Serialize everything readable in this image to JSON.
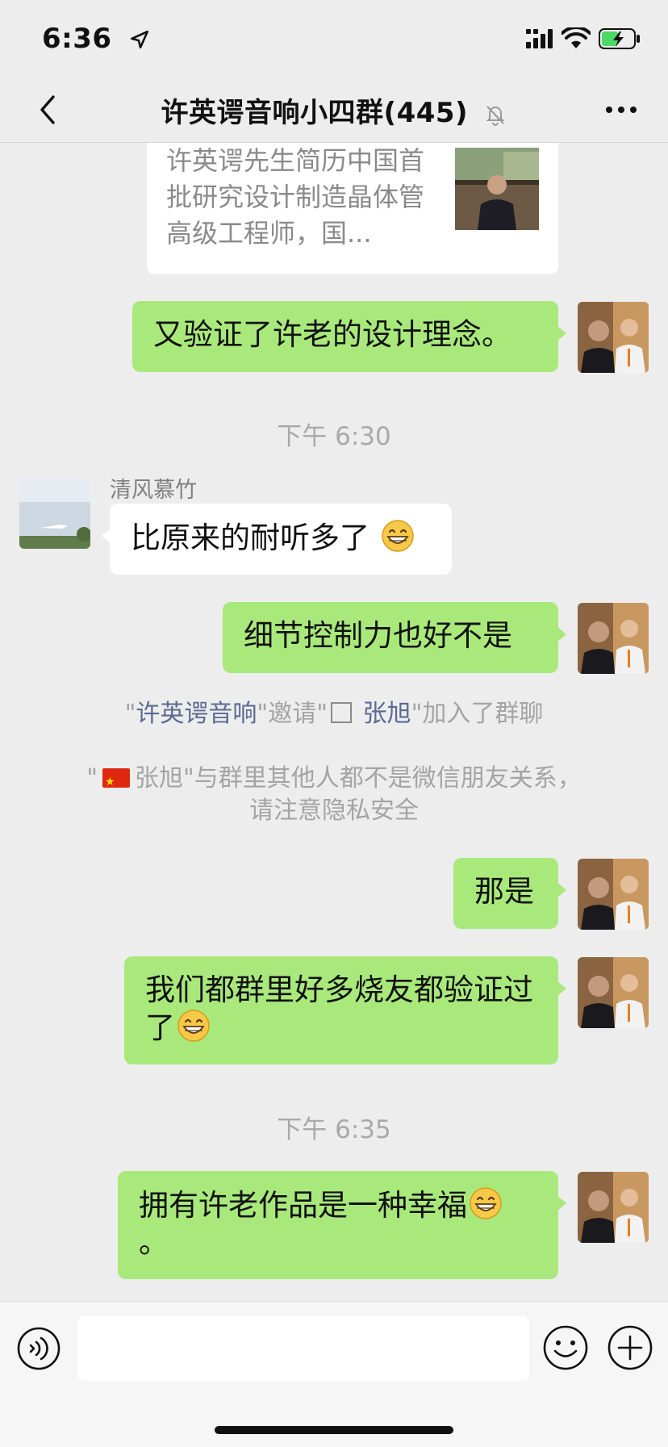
{
  "status_bar": {
    "time": "6:36",
    "icons": [
      "location-arrow-icon",
      "cellular-signal-icon",
      "wifi-icon",
      "battery-charging-icon"
    ]
  },
  "nav": {
    "title": "许英谔音响小四群(445)",
    "back_icon": "chevron-left-icon",
    "mute_icon": "bell-muted-icon",
    "more_icon": "more-dots-icon"
  },
  "link_card": {
    "text": "许英谔先生简历中国首批研究设计制造晶体管高级工程师，国..."
  },
  "messages": {
    "m1": "又验证了许老的设计理念。",
    "time1": "下午 6:30",
    "sender1": "清风慕竹",
    "m2": "比原来的耐听多了",
    "m3": "细节控制力也好不是",
    "m4": "那是",
    "m5": "我们都群里好多烧友都验证过了",
    "time2": "下午 6:35",
    "m6_line1": "拥有许老作品是一种幸福",
    "m6_line2": "。"
  },
  "system": {
    "s1_q1": "\"",
    "s1_link1": "许英谔音响",
    "s1_mid": "\"邀请\"",
    "s1_link2": "张旭",
    "s1_end": "\"加入了群聊",
    "s2_pre": "\"",
    "s2_name": "张旭",
    "s2_text1": "\"与群里其他人都不是微信朋友关系，",
    "s2_text2": "请注意隐私安全"
  },
  "colors": {
    "background": "#ededed",
    "bubble_me": "#a9e97b",
    "bubble_other": "#ffffff",
    "system_link": "#5b6a91"
  }
}
